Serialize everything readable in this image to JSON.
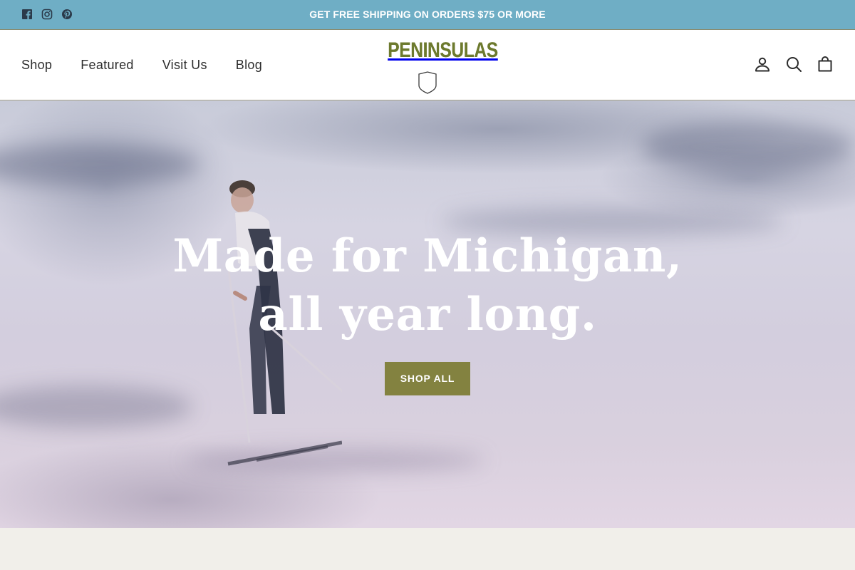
{
  "announcement": {
    "text": "GET FREE SHIPPING ON ORDERS $75 OR MORE",
    "social_icons": [
      "facebook-icon",
      "instagram-icon",
      "pinterest-icon"
    ],
    "background_color": "#6faec5"
  },
  "header": {
    "nav": [
      {
        "label": "Shop"
      },
      {
        "label": "Featured"
      },
      {
        "label": "Visit Us"
      },
      {
        "label": "Blog"
      }
    ],
    "logo": {
      "text": "PENINSULAS",
      "color": "#6d7a2e"
    },
    "icons": [
      "account-icon",
      "search-icon",
      "cart-icon"
    ]
  },
  "hero": {
    "title": "Made for Michigan, all year long.",
    "cta_label": "SHOP ALL",
    "cta_color": "#838240"
  }
}
